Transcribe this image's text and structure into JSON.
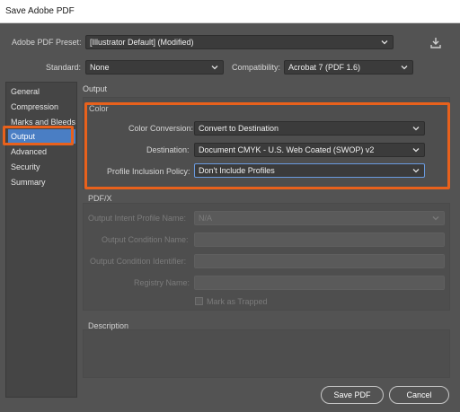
{
  "window": {
    "title": "Save Adobe PDF"
  },
  "header": {
    "preset_label": "Adobe PDF Preset:",
    "preset_value": "[Illustrator Default] (Modified)",
    "standard_label": "Standard:",
    "standard_value": "None",
    "compat_label": "Compatibility:",
    "compat_value": "Acrobat 7 (PDF 1.6)"
  },
  "sidebar": {
    "items": [
      {
        "label": "General"
      },
      {
        "label": "Compression"
      },
      {
        "label": "Marks and Bleeds"
      },
      {
        "label": "Output"
      },
      {
        "label": "Advanced"
      },
      {
        "label": "Security"
      },
      {
        "label": "Summary"
      }
    ],
    "active_index": 3
  },
  "main": {
    "section_title": "Output",
    "color": {
      "title": "Color",
      "conversion_label": "Color Conversion:",
      "conversion_value": "Convert to Destination",
      "destination_label": "Destination:",
      "destination_value": "Document CMYK - U.S. Web Coated (SWOP) v2",
      "profile_label": "Profile Inclusion Policy:",
      "profile_value": "Don't Include Profiles"
    },
    "pdfx": {
      "title": "PDF/X",
      "intent_label": "Output Intent Profile Name:",
      "intent_value": "N/A",
      "condition_label": "Output Condition Name:",
      "identifier_label": "Output Condition Identifier:",
      "registry_label": "Registry Name:",
      "trapped_label": "Mark as Trapped"
    },
    "description": {
      "title": "Description"
    }
  },
  "footer": {
    "save_label": "Save PDF",
    "cancel_label": "Cancel"
  },
  "colors": {
    "accent": "#4a7ec4",
    "highlight": "#e8611c"
  }
}
